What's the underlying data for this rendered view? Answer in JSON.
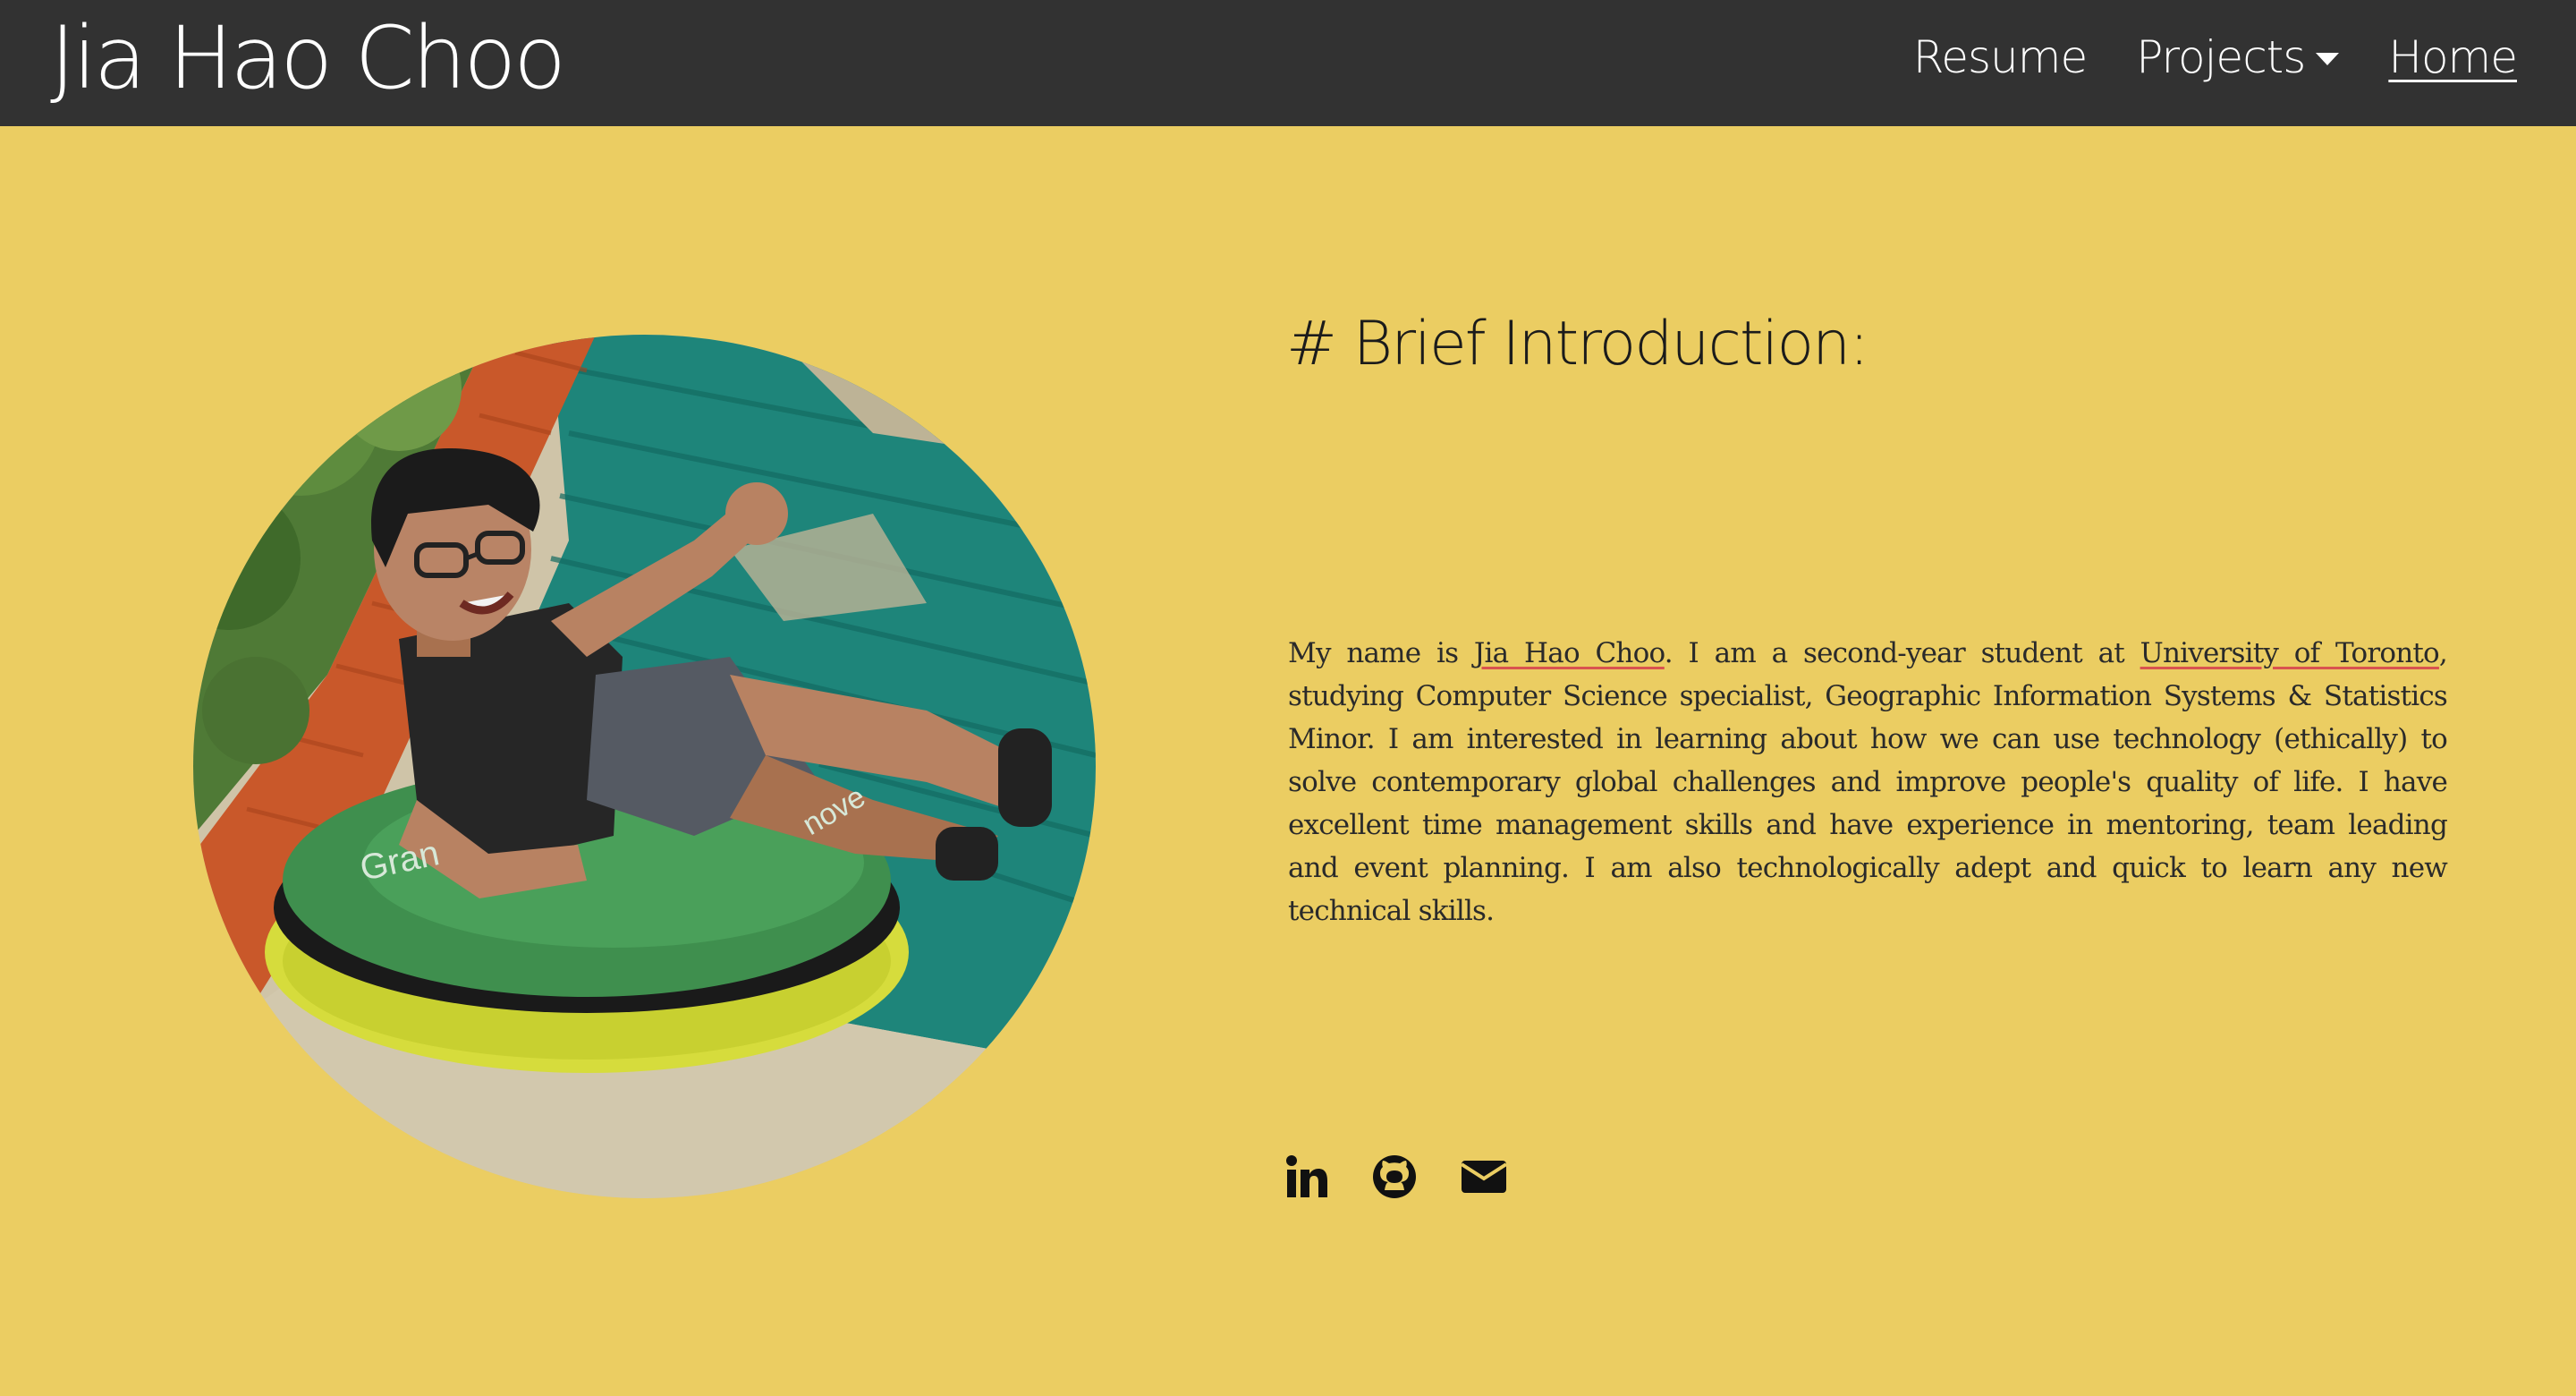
{
  "navbar": {
    "brand": "Jia Hao Choo",
    "links": {
      "resume": "Resume",
      "projects": "Projects",
      "home": "Home"
    },
    "icons": {
      "projects_dropdown": "caret-down-icon"
    }
  },
  "profile_photo": {
    "kind": "photo",
    "shape": "circle"
  },
  "intro": {
    "heading": "# Brief Introduction:",
    "bio_parts": {
      "p1": "My name is ",
      "name_link": "Jia Hao Choo",
      "p2": ". I am a second-year student at ",
      "university_link": "University of Toronto",
      "p3": ", studying Computer Science specialist, Geographic Information Systems & Statistics Minor. I am interested in learning about how we can use technology (ethically) to solve contemporary global challenges and improve people's quality of life. I have excellent time management skills and have experience in mentoring, team leading and event planning. I am also technologically adept and quick to learn any new technical skills."
    }
  },
  "social": [
    {
      "icon": "linkedin-icon"
    },
    {
      "icon": "github-icon"
    },
    {
      "icon": "envelope-icon"
    }
  ],
  "colors": {
    "navbar_bg": "#323232",
    "page_bg": "#ebcd62",
    "link_underline": "#d9534f"
  }
}
